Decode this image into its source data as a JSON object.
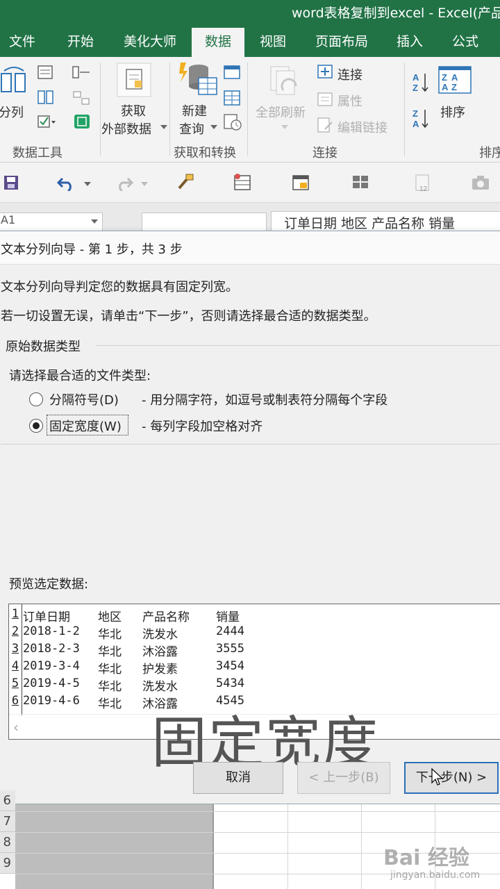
{
  "window": {
    "title": "word表格复制到excel - Excel(产品"
  },
  "tabs": [
    "文件",
    "开始",
    "美化大师",
    "数据",
    "视图",
    "页面布局",
    "插入",
    "公式"
  ],
  "active_tab": "数据",
  "ribbon": {
    "split_btn": "分列",
    "get_external": [
      "获取",
      "外部数据"
    ],
    "new_query": [
      "新建",
      "查询"
    ],
    "refresh_all": "全部刷新",
    "connections": "连接",
    "properties": "属性",
    "edit_links": "编辑链接",
    "sort": "排序",
    "groups": {
      "data_tools": "数据工具",
      "get_transform": "获取和转换",
      "connections": "连接",
      "sort_filter": "排序"
    }
  },
  "formula_bar": {
    "namebox": "A1",
    "formula": "订单日期  地区  产品名称  销量"
  },
  "dialog": {
    "title": "文本分列向导 - 第 1 步，共 3 步",
    "line1": "文本分列向导判定您的数据具有固定列宽。",
    "line2": "若一切设置无误，请单击“下一步”，否则请选择最合适的数据类型。",
    "group_title": "原始数据类型",
    "choose_label": "请选择最合适的文件类型:",
    "options": [
      {
        "label": "分隔符号(D)",
        "desc": "- 用分隔字符，如逗号或制表符分隔每个字段",
        "selected": false
      },
      {
        "label": "固定宽度(W)",
        "desc": "- 每列字段加空格对齐",
        "selected": true
      }
    ],
    "preview_label": "预览选定数据:",
    "preview_rows": [
      {
        "num": "1",
        "cells": [
          "订单日期",
          "地区",
          "产品名称",
          "销量"
        ]
      },
      {
        "num": "2",
        "cells": [
          "2018-1-2",
          "华北",
          "洗发水",
          "2444"
        ]
      },
      {
        "num": "3",
        "cells": [
          "2018-2-3",
          "华北",
          "沐浴露",
          "3555"
        ]
      },
      {
        "num": "4",
        "cells": [
          "2019-3-4",
          "华北",
          "护发素",
          "3454"
        ]
      },
      {
        "num": "5",
        "cells": [
          "2019-4-5",
          "华北",
          "洗发水",
          "5434"
        ]
      },
      {
        "num": "6",
        "cells": [
          "2019-4-6",
          "华北",
          "沐浴露",
          "4545"
        ]
      }
    ],
    "overlay_caption": "固定宽度",
    "buttons": {
      "cancel": "取消",
      "back": "< 上一步(B)",
      "next": "下一步(N) >"
    }
  },
  "sheet": {
    "row_headers": [
      "6",
      "7",
      "8",
      "9"
    ]
  },
  "watermark": {
    "main": "Bai 经验",
    "sub": "jingyan.baidu.com"
  }
}
